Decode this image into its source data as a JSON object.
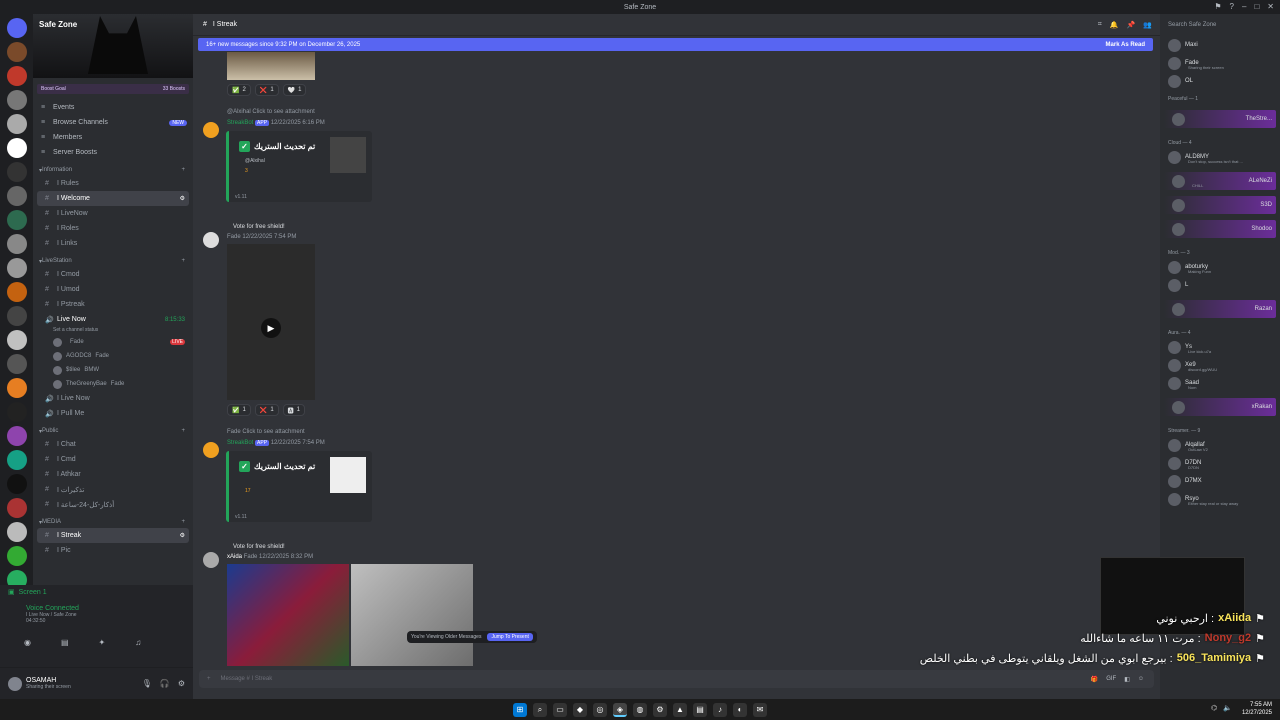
{
  "app": {
    "title": "Safe Zone"
  },
  "server": {
    "name": "Safe Zone",
    "boost_goal": "Boost Goal",
    "boosts": "33 Boosts"
  },
  "nav": [
    {
      "label": "Events",
      "icon": "calendar-icon"
    },
    {
      "label": "Browse Channels",
      "icon": "browse-icon",
      "badge": "NEW"
    },
    {
      "label": "Members",
      "icon": "members-icon"
    },
    {
      "label": "Server Boosts",
      "icon": "boost-icon"
    }
  ],
  "categories": {
    "info": "Information",
    "live": "LiveStation",
    "public": "Public",
    "media": "MEDIA"
  },
  "info_channels": [
    "Rules",
    "Welcome",
    "LiveNow",
    "Roles",
    "Links"
  ],
  "live_channels": [
    "Cmod",
    "Umod",
    "Pstreak"
  ],
  "live_now": {
    "name": "Live Now",
    "time": "8:15:33",
    "status": "Set a channel status"
  },
  "live_users": [
    {
      "name": "",
      "tag": "Fade",
      "live": "LIVE"
    },
    {
      "name": "AGODC8",
      "tag": "Fade"
    },
    {
      "name": "$tilee",
      "tag": "BMW"
    },
    {
      "name": "TheGreenyBae",
      "tag": "Fade"
    }
  ],
  "voice_channels": [
    "Live Now",
    "Pull Me"
  ],
  "public_channels": [
    "Chat",
    "Cmd",
    "Athkar",
    "تذكيرات",
    "أذكار-كل-24-ساعة"
  ],
  "media_channels": [
    "Streak",
    "Pic"
  ],
  "voice_panel": {
    "screen": "Screen 1",
    "screen_sub": "Stream is active",
    "connected": "Voice Connected",
    "location": "I Live Now / Safe Zone",
    "duration": "04:32:50"
  },
  "user": {
    "name": "OSAMAH",
    "status": "Sharing their screen"
  },
  "channel": {
    "name": "I Streak"
  },
  "new_messages": {
    "text": "16+ new messages since 9:32 PM on December 26, 2025",
    "action": "Mark As Read"
  },
  "messages": [
    {
      "reactions": [
        {
          "e": "✅",
          "c": "2"
        },
        {
          "e": "❌",
          "c": "1"
        },
        {
          "e": "🤍",
          "c": "1"
        }
      ]
    },
    {
      "reply": "@Alxihal Click to see attachment",
      "author": "StreakBot",
      "app": "APP",
      "time": "12/22/2025 6:16 PM",
      "title": "تم تحديث الستريك",
      "mention": "@Alxihal",
      "count": "3",
      "version": "v1.11",
      "vote": "Vote for free shield!"
    },
    {
      "author": "",
      "tag": "Fade",
      "time": "12/22/2025 7:54 PM",
      "reactions": [
        {
          "e": "✅",
          "c": "1"
        },
        {
          "e": "❌",
          "c": "1"
        },
        {
          "e": "🅰",
          "c": "1"
        }
      ]
    },
    {
      "reply": "Fade Click to see attachment",
      "author": "StreakBot",
      "app": "APP",
      "time": "12/22/2025 7:54 PM",
      "title": "تم تحديث الستريك",
      "count": "17",
      "version": "v1.11",
      "vote": "Vote for free shield!"
    },
    {
      "author": "xAida",
      "tag": "Fade",
      "time": "12/22/2025 8:32 PM"
    }
  ],
  "older": {
    "text": "You're Viewing Older Messages",
    "jump": "Jump To Present"
  },
  "composer": {
    "placeholder": "Message # I Streak"
  },
  "overlay": [
    {
      "nick": "xAiida",
      "text": "ارحبي نوني",
      "style": "gold"
    },
    {
      "nick": "Nony_g2",
      "text": "مرت ١١ ساعه ما شاءالله",
      "style": "red"
    },
    {
      "nick": "506_Tamimiya",
      "text": "بيرجع ابوي من الشغل ويلقاني يتوطى في بطني الخلص",
      "style": "gold"
    }
  ],
  "members_panel": {
    "search": "Search Safe Zone",
    "top": [
      {
        "name": "Maxi",
        "sub": ""
      },
      {
        "name": "Fade",
        "sub": "Sharing their screen"
      },
      {
        "name": "OL",
        "sub": ""
      }
    ],
    "groups": [
      {
        "label": "Peaceful — 1",
        "members": [
          {
            "name": "TheStre...",
            "sub": "",
            "boost": true
          }
        ]
      },
      {
        "label": "Cloud — 4",
        "members": [
          {
            "name": "ALD8MY",
            "sub": "Don't stop, success isn't that ..."
          },
          {
            "name": "ALeNeZi",
            "sub": "CHILL",
            "boost": true
          },
          {
            "name": "S3D",
            "sub": "",
            "boost": true
          },
          {
            "name": "Shodoo",
            "sub": "",
            "boost": true
          }
        ]
      },
      {
        "label": "Mod. — 3",
        "members": [
          {
            "name": "aboturky",
            "sub": "Making Funn"
          },
          {
            "name": "L",
            "sub": ""
          },
          {
            "name": "Razan",
            "sub": "",
            "boost": true
          }
        ]
      },
      {
        "label": "Aura. — 4",
        "members": [
          {
            "name": "Ys",
            "sub": "Live kick.u7a"
          },
          {
            "name": "Xe9",
            "sub": "discord.gg/WUU"
          },
          {
            "name": "Saad",
            "sub": "Nom"
          },
          {
            "name": "xRakan",
            "sub": "",
            "boost": true
          }
        ]
      },
      {
        "label": "Streamer. — 9",
        "members": [
          {
            "name": "Alqallaf",
            "sub": "OutLaw V2"
          },
          {
            "name": "D7DN",
            "sub": "D7DN"
          },
          {
            "name": "D7MX",
            "sub": ""
          },
          {
            "name": "Rsyo",
            "sub": "Either stay real or stay away"
          }
        ]
      }
    ]
  },
  "clock": {
    "time": "7:55 AM",
    "date": "12/27/2025"
  },
  "colors": {
    "accent": "#5865f2",
    "bg": "#313338",
    "sidebar": "#2b2d31",
    "green": "#23a55a",
    "red": "#da373c"
  }
}
